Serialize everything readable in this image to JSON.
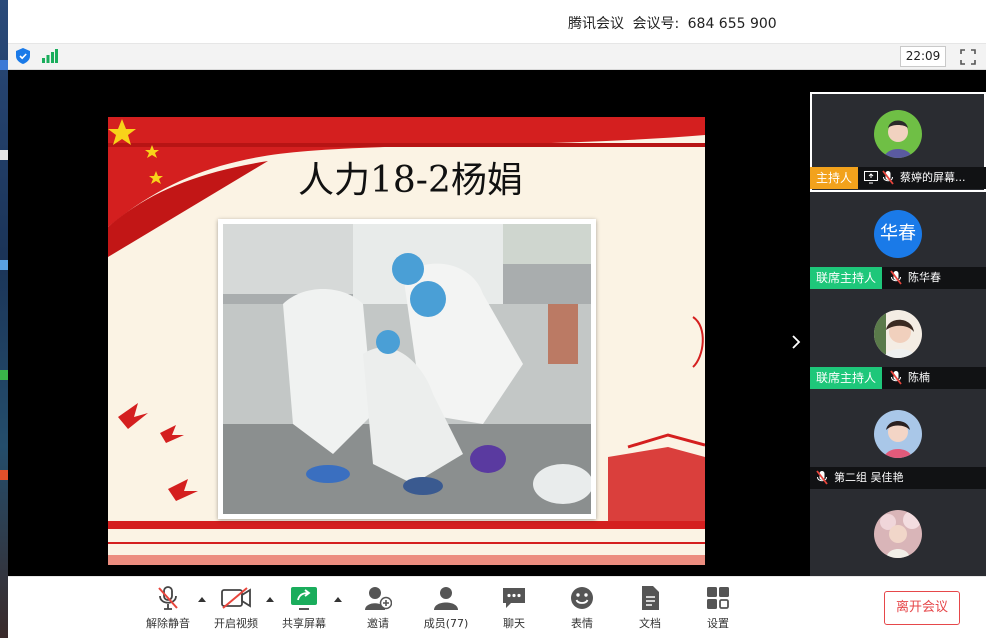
{
  "window": {
    "title": "腾讯会议",
    "meeting_id_label": "会议号:",
    "meeting_id": "684 655 900"
  },
  "statusbar": {
    "time": "22:09",
    "icons": [
      "shield-icon",
      "signal-icon",
      "fullscreen-icon"
    ]
  },
  "slide": {
    "title": "人力18-2杨娟"
  },
  "participants": [
    {
      "role": "主持人",
      "role_color": "#f2a21c",
      "name": "蔡婷的屏幕...",
      "avatar": "photo",
      "sharing": true
    },
    {
      "role": "联席主持人",
      "role_color": "#1ec77a",
      "name": "陈华春",
      "avatar_text": "华春",
      "sharing": false
    },
    {
      "role": "联席主持人",
      "role_color": "#1ec77a",
      "name": "陈楠",
      "avatar": "photo",
      "sharing": false
    },
    {
      "role": "",
      "name": "第二组 吴佳艳",
      "avatar": "photo",
      "sharing": false
    }
  ],
  "toolbar": {
    "unmute": "解除静音",
    "start_video": "开启视频",
    "share_screen": "共享屏幕",
    "invite": "邀请",
    "members": "成员(77)",
    "chat": "聊天",
    "reactions": "表情",
    "docs": "文档",
    "settings": "设置",
    "leave": "离开会议"
  },
  "colors": {
    "accent_blue": "#1a7ae8",
    "leave_red": "#e6474a",
    "host_orange": "#f2a21c",
    "cohost_green": "#1ec77a",
    "share_green": "#1aad5c"
  }
}
